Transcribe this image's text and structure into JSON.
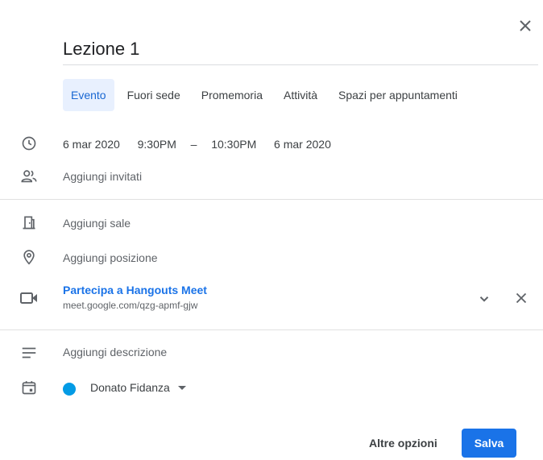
{
  "title": "Lezione 1",
  "tabs": [
    {
      "label": "Evento"
    },
    {
      "label": "Fuori sede"
    },
    {
      "label": "Promemoria"
    },
    {
      "label": "Attività"
    },
    {
      "label": "Spazi per appuntamenti"
    }
  ],
  "datetime": {
    "start_date": "6 mar 2020",
    "start_time": "9:30PM",
    "separator": "–",
    "end_time": "10:30PM",
    "end_date": "6 mar 2020"
  },
  "guests": {
    "label": "Aggiungi invitati"
  },
  "rooms": {
    "label": "Aggiungi sale"
  },
  "location": {
    "label": "Aggiungi posizione"
  },
  "meet": {
    "link": "Partecipa a Hangouts Meet",
    "url": "meet.google.com/qzg-apmf-gjw"
  },
  "description": {
    "label": "Aggiungi descrizione"
  },
  "calendar": {
    "owner": "Donato Fidanza",
    "color": "#039be5"
  },
  "footer": {
    "more_options": "Altre opzioni",
    "save": "Salva"
  },
  "colors": {
    "accent": "#1a73e8",
    "tab_active_bg": "#e8f0fe"
  },
  "icons": [
    "close-icon",
    "clock-icon",
    "people-icon",
    "door-icon",
    "location-pin-icon",
    "video-camera-icon",
    "chevron-down-icon",
    "description-lines-icon",
    "calendar-icon",
    "caret-down-icon"
  ]
}
